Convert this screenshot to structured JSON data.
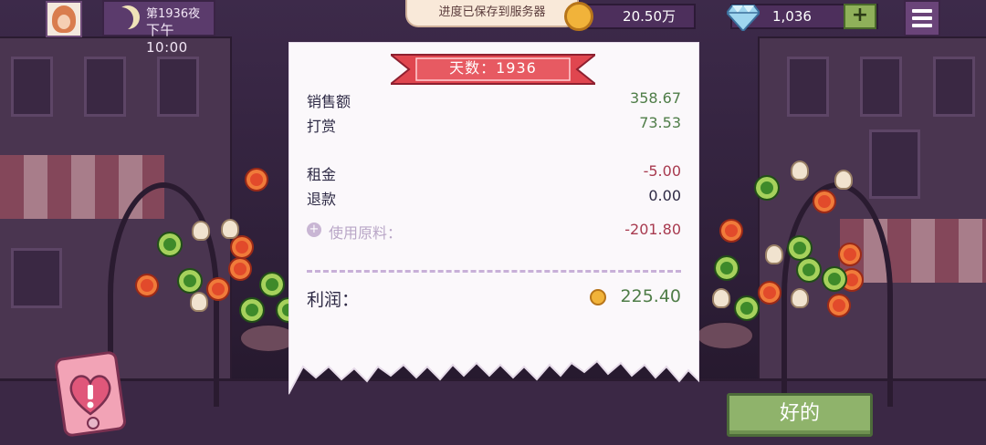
{
  "header": {
    "night_label": "第1936夜",
    "clock": "下午10:00",
    "toast": "进度已保存到服务器",
    "coins": "20.50万",
    "gems": "1,036",
    "plus_label": "+"
  },
  "receipt": {
    "day_banner": "天数：1936",
    "rows": [
      {
        "label": "销售额",
        "value": "358.67"
      },
      {
        "label": "打赏",
        "value": "73.53"
      },
      {
        "label": "租金",
        "value": "-5.00"
      },
      {
        "label": "退款",
        "value": "0.00"
      },
      {
        "label": "使用原料：",
        "value": "-201.80"
      }
    ],
    "profit_label": "利润：",
    "profit_value": "225.40"
  },
  "ok_button": "好的",
  "colors": {
    "positive": "#4f7d48",
    "negative": "#a83a4f",
    "banner": "#e0464f",
    "button": "#8fb36b",
    "coin": "#f1b33a"
  },
  "icons": [
    "avatar",
    "moon-icon",
    "coin-icon",
    "gem-icon",
    "plus-icon",
    "menu-icon",
    "alert-heart-icon"
  ]
}
